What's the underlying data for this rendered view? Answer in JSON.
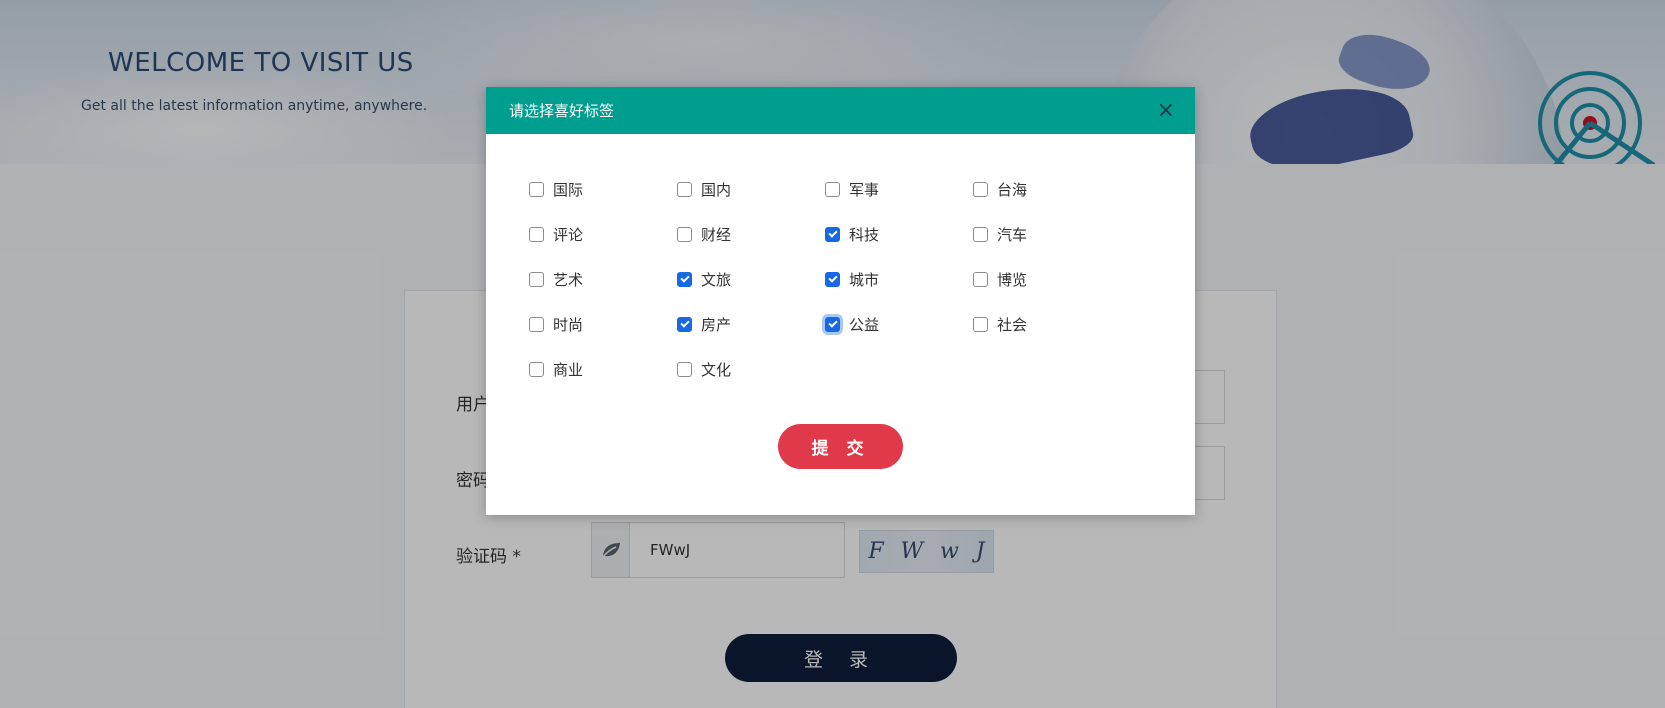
{
  "banner": {
    "title": "WELCOME TO VISIT US",
    "subtitle": "Get all the latest information anytime, anywhere."
  },
  "login": {
    "username_label": "用户",
    "password_label": "密码",
    "captcha_label": "验证码 *",
    "captcha_value": "FWwJ",
    "captcha_image_text": [
      "F",
      "W",
      "w",
      "J"
    ],
    "login_button": "登 录"
  },
  "modal": {
    "title": "请选择喜好标签",
    "close_symbol": "×",
    "submit_label": "提 交",
    "tags": [
      {
        "label": "国际",
        "checked": false
      },
      {
        "label": "国内",
        "checked": false
      },
      {
        "label": "军事",
        "checked": false
      },
      {
        "label": "台海",
        "checked": false
      },
      {
        "label": "评论",
        "checked": false
      },
      {
        "label": "财经",
        "checked": false
      },
      {
        "label": "科技",
        "checked": true
      },
      {
        "label": "汽车",
        "checked": false
      },
      {
        "label": "艺术",
        "checked": false
      },
      {
        "label": "文旅",
        "checked": true
      },
      {
        "label": "城市",
        "checked": true
      },
      {
        "label": "博览",
        "checked": false
      },
      {
        "label": "时尚",
        "checked": false
      },
      {
        "label": "房产",
        "checked": true
      },
      {
        "label": "公益",
        "checked": true,
        "focused": true
      },
      {
        "label": "社会",
        "checked": false
      },
      {
        "label": "商业",
        "checked": false
      },
      {
        "label": "文化",
        "checked": false
      }
    ]
  },
  "colors": {
    "modal_header": "#009e8f",
    "submit_button": "#e0394a",
    "login_button": "#0e1e3e",
    "checkbox_checked": "#1668e3"
  },
  "icons": {
    "close": "close-icon",
    "captcha_addon": "leaf-icon",
    "banner_logo": "radar-icon"
  }
}
